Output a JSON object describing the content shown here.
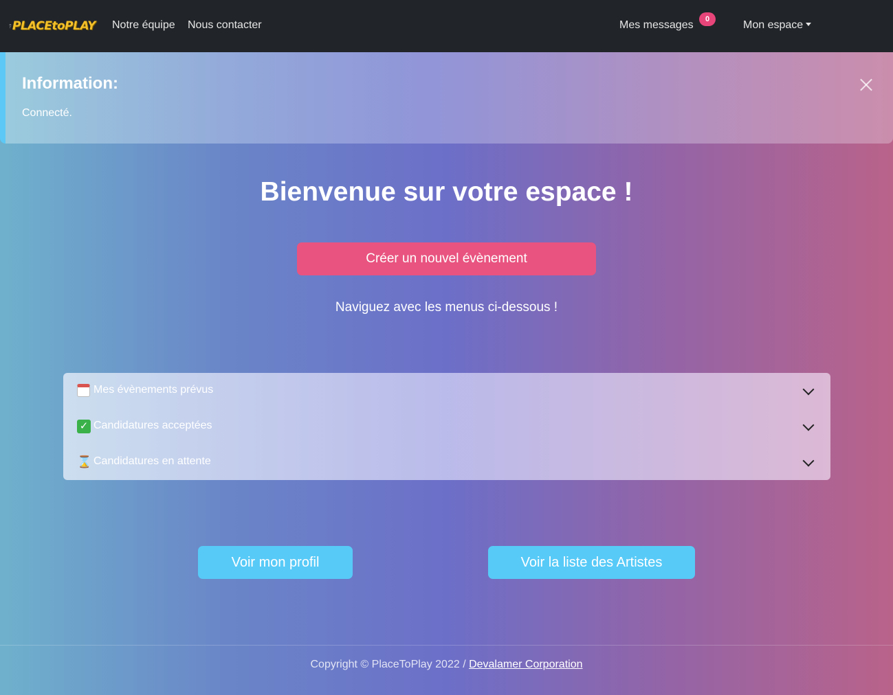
{
  "navbar": {
    "logo_text": "PLACEtoPLAY",
    "links": {
      "team": "Notre équipe",
      "contact": "Nous contacter",
      "messages": "Mes messages",
      "space": "Mon espace"
    },
    "messages_count": "0"
  },
  "alert": {
    "title": "Information:",
    "text": "Connecté."
  },
  "main": {
    "welcome": "Bienvenue sur votre espace !",
    "create_button": "Créer un nouvel évènement",
    "hint": "Naviguez avec les menus ci-dessous !"
  },
  "accordion": {
    "items": [
      {
        "icon": "calendar-icon",
        "label": "Mes évènements prévus"
      },
      {
        "icon": "check-icon",
        "label": "Candidatures acceptées"
      },
      {
        "icon": "hourglass-icon",
        "label": "Candidatures en attente"
      }
    ]
  },
  "actions": {
    "profile": "Voir mon profil",
    "artists": "Voir la liste des Artistes"
  },
  "footer": {
    "copyright": "Copyright © PlaceToPlay 2022 / ",
    "company": "Devalamer Corporation"
  },
  "colors": {
    "navbar": "#212529",
    "badge": "#e8467b",
    "primary_button": "#e8547f",
    "secondary_button": "#58caf8",
    "logo": "#f3c02a"
  }
}
